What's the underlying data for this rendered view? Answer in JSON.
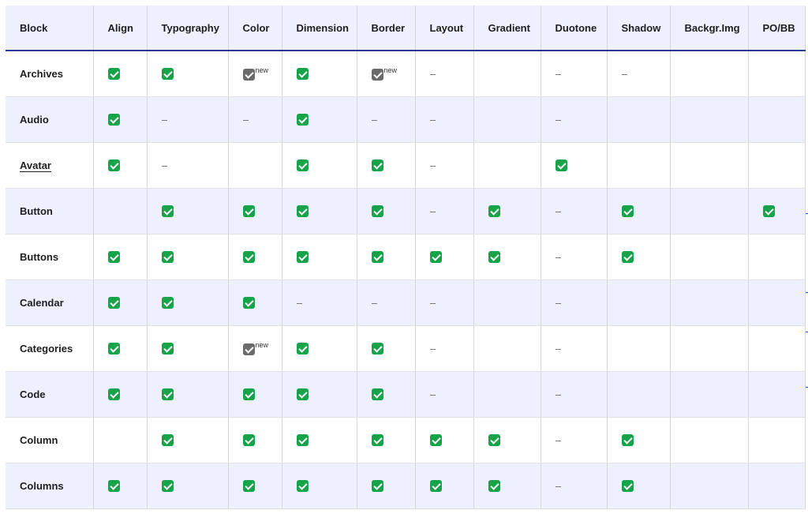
{
  "columns": [
    "Block",
    "Align",
    "Typography",
    "Color",
    "Dimension",
    "Border",
    "Layout",
    "Gradient",
    "Duotone",
    "Shadow",
    "Backgr.Img",
    "PO/BB"
  ],
  "new_label": "new",
  "rows": [
    {
      "name": "Archives",
      "cells": [
        "check",
        "check",
        "gray-new",
        "check",
        "gray-new",
        "dash",
        "",
        "dash",
        "dash",
        "",
        ""
      ]
    },
    {
      "name": "Audio",
      "cells": [
        "check",
        "dash",
        "dash",
        "check",
        "dash",
        "dash",
        "",
        "dash",
        "",
        "",
        ""
      ]
    },
    {
      "name": "Avatar",
      "cells": [
        "check",
        "dash",
        "",
        "check",
        "check",
        "dash",
        "",
        "check",
        "",
        "",
        ""
      ]
    },
    {
      "name": "Button",
      "cells": [
        "",
        "check",
        "check",
        "check",
        "check",
        "dash",
        "check",
        "dash",
        "check",
        "",
        "check"
      ]
    },
    {
      "name": "Buttons",
      "cells": [
        "check",
        "check",
        "check",
        "check",
        "check",
        "check",
        "check",
        "dash",
        "check",
        "",
        ""
      ]
    },
    {
      "name": "Calendar",
      "cells": [
        "check",
        "check",
        "check",
        "dash",
        "dash",
        "dash",
        "",
        "dash",
        "",
        "",
        ""
      ]
    },
    {
      "name": "Categories",
      "cells": [
        "check",
        "check",
        "gray-new",
        "check",
        "check",
        "dash",
        "",
        "dash",
        "",
        "",
        ""
      ]
    },
    {
      "name": "Code",
      "cells": [
        "check",
        "check",
        "check",
        "check",
        "check",
        "dash",
        "",
        "dash",
        "",
        "",
        ""
      ]
    },
    {
      "name": "Column",
      "cells": [
        "",
        "check",
        "check",
        "check",
        "check",
        "check",
        "check",
        "dash",
        "check",
        "",
        ""
      ]
    },
    {
      "name": "Columns",
      "cells": [
        "check",
        "check",
        "check",
        "check",
        "check",
        "check",
        "check",
        "dash",
        "check",
        "",
        ""
      ]
    }
  ],
  "colors": {
    "accent_border": "#2b3a8f",
    "check_green": "#16a34a",
    "alt_row": "#eef1fd"
  }
}
